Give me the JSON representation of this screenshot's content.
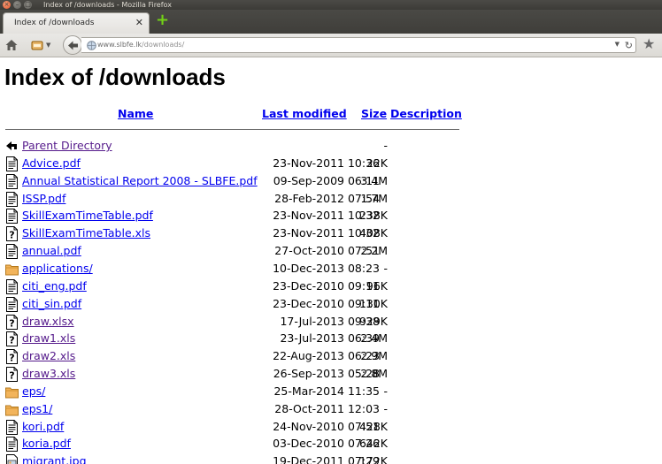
{
  "window": {
    "title": "Index of /downloads - Mozilla Firefox"
  },
  "tab": {
    "label": "Index of /downloads",
    "close": "✕"
  },
  "toolbar": {
    "url_domain": "www.slbfe.lk",
    "url_path": "/downloads/"
  },
  "page": {
    "heading": "Index of /downloads",
    "columns": {
      "name": "Name",
      "modified": "Last modified",
      "size": "Size",
      "description": "Description"
    }
  },
  "files": [
    {
      "name": "Parent Directory",
      "date": "",
      "size": "-",
      "icon": "back-icon",
      "visited": true
    },
    {
      "name": "Advice.pdf",
      "date": "23-Nov-2011 10:36",
      "size": "22K",
      "icon": "text-file-icon",
      "visited": false
    },
    {
      "name": "Annual Statistical Report 2008 - SLBFE.pdf",
      "date": "09-Sep-2009 06:11",
      "size": "3.4M",
      "icon": "text-file-icon",
      "visited": false
    },
    {
      "name": "ISSP.pdf",
      "date": "28-Feb-2012 07:54",
      "size": "1.7M",
      "icon": "text-file-icon",
      "visited": false
    },
    {
      "name": "SkillExamTimeTable.pdf",
      "date": "23-Nov-2011 10:32",
      "size": "238K",
      "icon": "text-file-icon",
      "visited": false
    },
    {
      "name": "SkillExamTimeTable.xls",
      "date": "23-Nov-2011 10:32",
      "size": "408K",
      "icon": "unknown-file-icon",
      "visited": false
    },
    {
      "name": "annual.pdf",
      "date": "27-Oct-2010 07:51",
      "size": "2.2M",
      "icon": "text-file-icon",
      "visited": false
    },
    {
      "name": "applications/",
      "date": "10-Dec-2013 08:23",
      "size": "-",
      "icon": "folder-icon",
      "visited": false
    },
    {
      "name": "citi_eng.pdf",
      "date": "23-Dec-2010 09:11",
      "size": "96K",
      "icon": "text-file-icon",
      "visited": false
    },
    {
      "name": "citi_sin.pdf",
      "date": "23-Dec-2010 09:11",
      "size": "130K",
      "icon": "text-file-icon",
      "visited": false
    },
    {
      "name": "draw.xlsx",
      "date": "17-Jul-2013 09:38",
      "size": "929K",
      "icon": "unknown-file-icon",
      "visited": true
    },
    {
      "name": "draw1.xls",
      "date": "23-Jul-2013 06:39",
      "size": "2.4M",
      "icon": "unknown-file-icon",
      "visited": true
    },
    {
      "name": "draw2.xls",
      "date": "22-Aug-2013 06:23",
      "size": "2.9M",
      "icon": "unknown-file-icon",
      "visited": true
    },
    {
      "name": "draw3.xls",
      "date": "26-Sep-2013 05:28",
      "size": "2.8M",
      "icon": "unknown-file-icon",
      "visited": true
    },
    {
      "name": "eps/",
      "date": "25-Mar-2014 11:35",
      "size": "-",
      "icon": "folder-icon",
      "visited": false
    },
    {
      "name": "eps1/",
      "date": "28-Oct-2011 12:03",
      "size": "-",
      "icon": "folder-icon",
      "visited": false
    },
    {
      "name": "kori.pdf",
      "date": "24-Nov-2010 07:51",
      "size": "428K",
      "icon": "text-file-icon",
      "visited": false
    },
    {
      "name": "koria.pdf",
      "date": "03-Dec-2010 07:26",
      "size": "642K",
      "icon": "text-file-icon",
      "visited": false
    },
    {
      "name": "migrant.jpg",
      "date": "19-Dec-2011 07:29",
      "size": "172K",
      "icon": "image-file-icon",
      "visited": false
    }
  ]
}
